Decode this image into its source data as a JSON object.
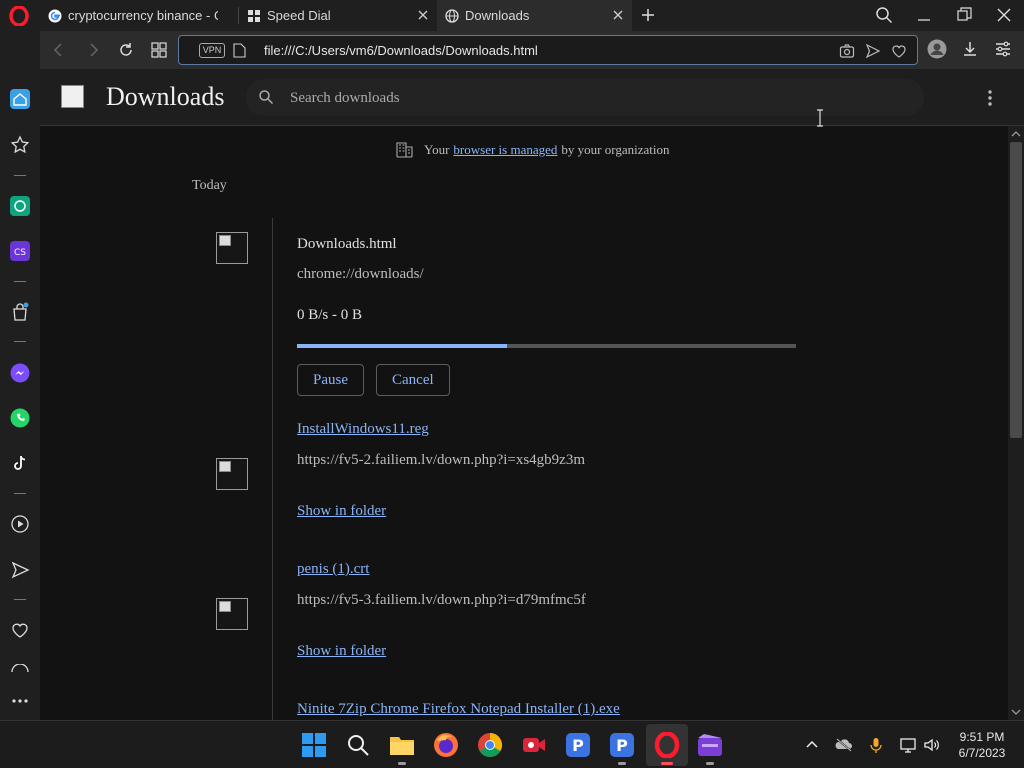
{
  "tabs": [
    {
      "title": "cryptocurrency binance - G",
      "favicon": "google-icon",
      "active": false
    },
    {
      "title": "Speed Dial",
      "favicon": "speed-dial-icon",
      "active": false
    },
    {
      "title": "Downloads",
      "favicon": "globe-icon",
      "active": true
    }
  ],
  "address_bar": {
    "vpn_label": "VPN",
    "url": "file:///C:/Users/vm6/Downloads/Downloads.html"
  },
  "page": {
    "title": "Downloads",
    "search_placeholder": "Search downloads"
  },
  "managed_notice": {
    "prefix": "Your",
    "link": "browser is managed",
    "suffix": "by your organization"
  },
  "section_label": "Today",
  "downloads": [
    {
      "name": "Downloads.html",
      "url": "chrome://downloads/",
      "status": "0 B/s - 0 B",
      "progress": 0.42,
      "pause_label": "Pause",
      "cancel_label": "Cancel"
    },
    {
      "name": "InstallWindows11.reg",
      "url": "https://fv5-2.failiem.lv/down.php?i=xs4gb9z3m",
      "action_label": "Show in folder"
    },
    {
      "name": "penis (1).crt",
      "url": "https://fv5-3.failiem.lv/down.php?i=d79mfmc5f",
      "action_label": "Show in folder"
    },
    {
      "name": "Ninite 7Zip Chrome Firefox Notepad Installer (1).exe"
    }
  ],
  "clock": {
    "time": "9:51 PM",
    "date": "6/7/2023"
  },
  "colors": {
    "accent": "#8ab4f8",
    "opera_red": "#ff1b2d",
    "background": "#121212"
  }
}
